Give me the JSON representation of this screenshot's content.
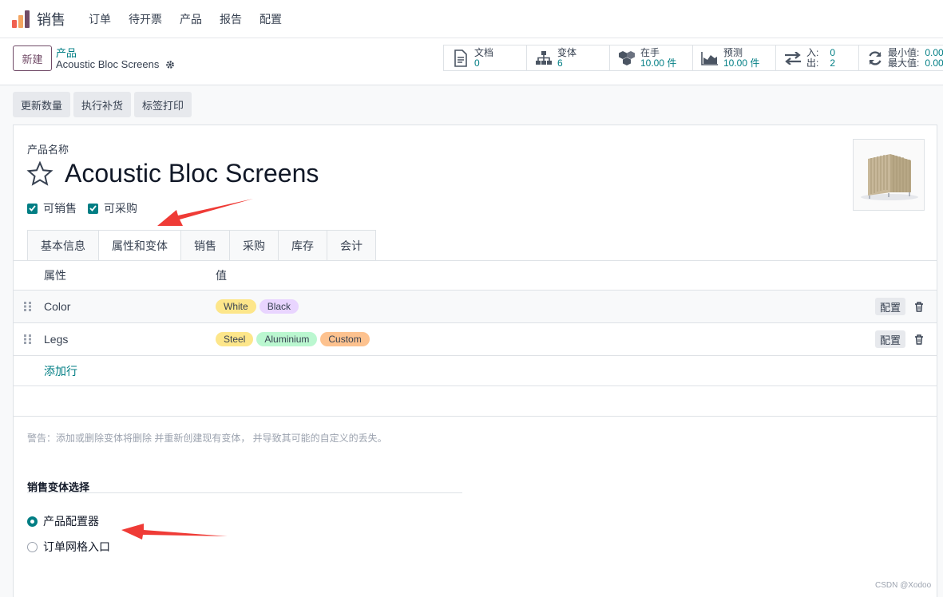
{
  "topbar": {
    "app_name": "销售",
    "menu": [
      "订单",
      "待开票",
      "产品",
      "报告",
      "配置"
    ],
    "logo_colors": [
      "#f06050",
      "#f4a460",
      "#714b67"
    ]
  },
  "control_panel": {
    "new_label": "新建",
    "breadcrumb_parent": "产品",
    "breadcrumb_current": "Acoustic Bloc Screens",
    "stats": {
      "documents": {
        "label": "文档",
        "value": "0"
      },
      "variants": {
        "label": "变体",
        "value": "6"
      },
      "on_hand": {
        "label": "在手",
        "value": "10.00 件"
      },
      "forecast": {
        "label": "预测",
        "value": "10.00 件"
      },
      "in_out": {
        "in_label": "入:",
        "in_value": "0",
        "out_label": "出:",
        "out_value": "2"
      },
      "min_max": {
        "min_label": "最小值:",
        "min_value": "0.00",
        "max_label": "最大值:",
        "max_value": "0.00"
      }
    }
  },
  "actions": [
    "更新数量",
    "执行补货",
    "标签打印"
  ],
  "form": {
    "name_label": "产品名称",
    "product_name": "Acoustic Bloc Screens",
    "can_be_sold": "可销售",
    "can_be_purchased": "可采购",
    "tabs": [
      "基本信息",
      "属性和变体",
      "销售",
      "采购",
      "库存",
      "会计"
    ],
    "active_tab": "属性和变体",
    "table": {
      "col_attribute": "属性",
      "col_values": "值",
      "rows": [
        {
          "name": "Color",
          "values": [
            {
              "text": "White",
              "color": "#fde68a"
            },
            {
              "text": "Black",
              "color": "#e9d5ff"
            }
          ]
        },
        {
          "name": "Legs",
          "values": [
            {
              "text": "Steel",
              "color": "#fde68a"
            },
            {
              "text": "Aluminium",
              "color": "#bbf7d0"
            },
            {
              "text": "Custom",
              "color": "#fdc28f"
            }
          ]
        }
      ],
      "configure_label": "配置",
      "add_line": "添加行"
    },
    "warning": "警告：添加或删除变体将删除 并重新创建现有变体， 并导致其可能的自定义的丢失。",
    "variant_section_title": "销售变体选择",
    "variant_options": [
      "产品配置器",
      "订单网格入口"
    ],
    "selected_option": "产品配置器"
  },
  "watermark": "CSDN @Xodoo",
  "colors": {
    "primary": "#714b67",
    "accent": "#017e84",
    "annotation_arrow": "#ef3b36"
  }
}
